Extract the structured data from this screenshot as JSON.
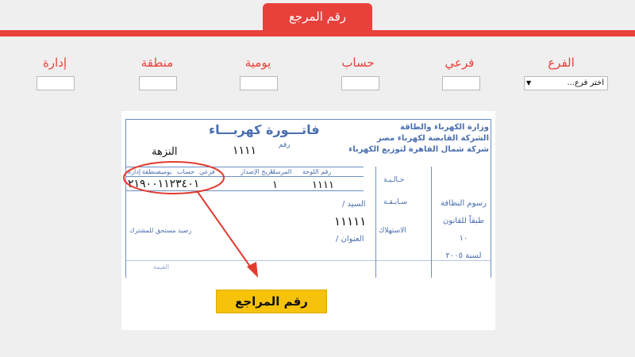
{
  "header": {
    "tab_title": "رقم المرجع"
  },
  "fields": {
    "branch_label": "الفرع",
    "sub_label": "فرعي",
    "account_label": "حساب",
    "daily_label": "يومية",
    "region_label": "منطقة",
    "admin_label": "إدارة",
    "branch_select_value": "اختر فرع..."
  },
  "invoice": {
    "ministry_l1": "وزارة الكهرباء والطاقة",
    "ministry_l2": "الشركة القابضة لكهرباء مصر",
    "ministry_l3": "شركة شمال القاهرة لتوزيع الكهرباء",
    "title": "فاتـــورة كهربـــاء",
    "raqm": "رقم",
    "number": "١١١١",
    "district": "النزهة",
    "col_board": "رقم اللوحة",
    "col_meter": "المرسلة",
    "col_issue": "تاريخ الإصدار",
    "col_sub": "فرعي",
    "col_account": "حساب",
    "col_daily": "يومية",
    "col_region": "منطقة",
    "col_admin": "إدارة",
    "ref_number": "٢١٩٠٠١١٢٣٤٠١",
    "board_value": "١١١١",
    "meter_value": "١",
    "current": "حـالـيـة",
    "previous": "سـابـقـة",
    "consumption": "الاستهلاك",
    "fees_l1": "رسوم النظافة",
    "fees_l2": "طبقاً للقانون ١٠",
    "fees_l3": "لسنة ٢٠٠٥",
    "mr": "السيد /",
    "name_value": "١١١١١",
    "address": "العنوان /",
    "balance": "رصيد مستحق للمشترك",
    "amount": "القيمة"
  },
  "callout": {
    "label": "رقم المراجع"
  },
  "colors": {
    "accent": "#e8413b",
    "callout_yellow": "#f7c20a",
    "form_blue": "#4a6fb0"
  }
}
